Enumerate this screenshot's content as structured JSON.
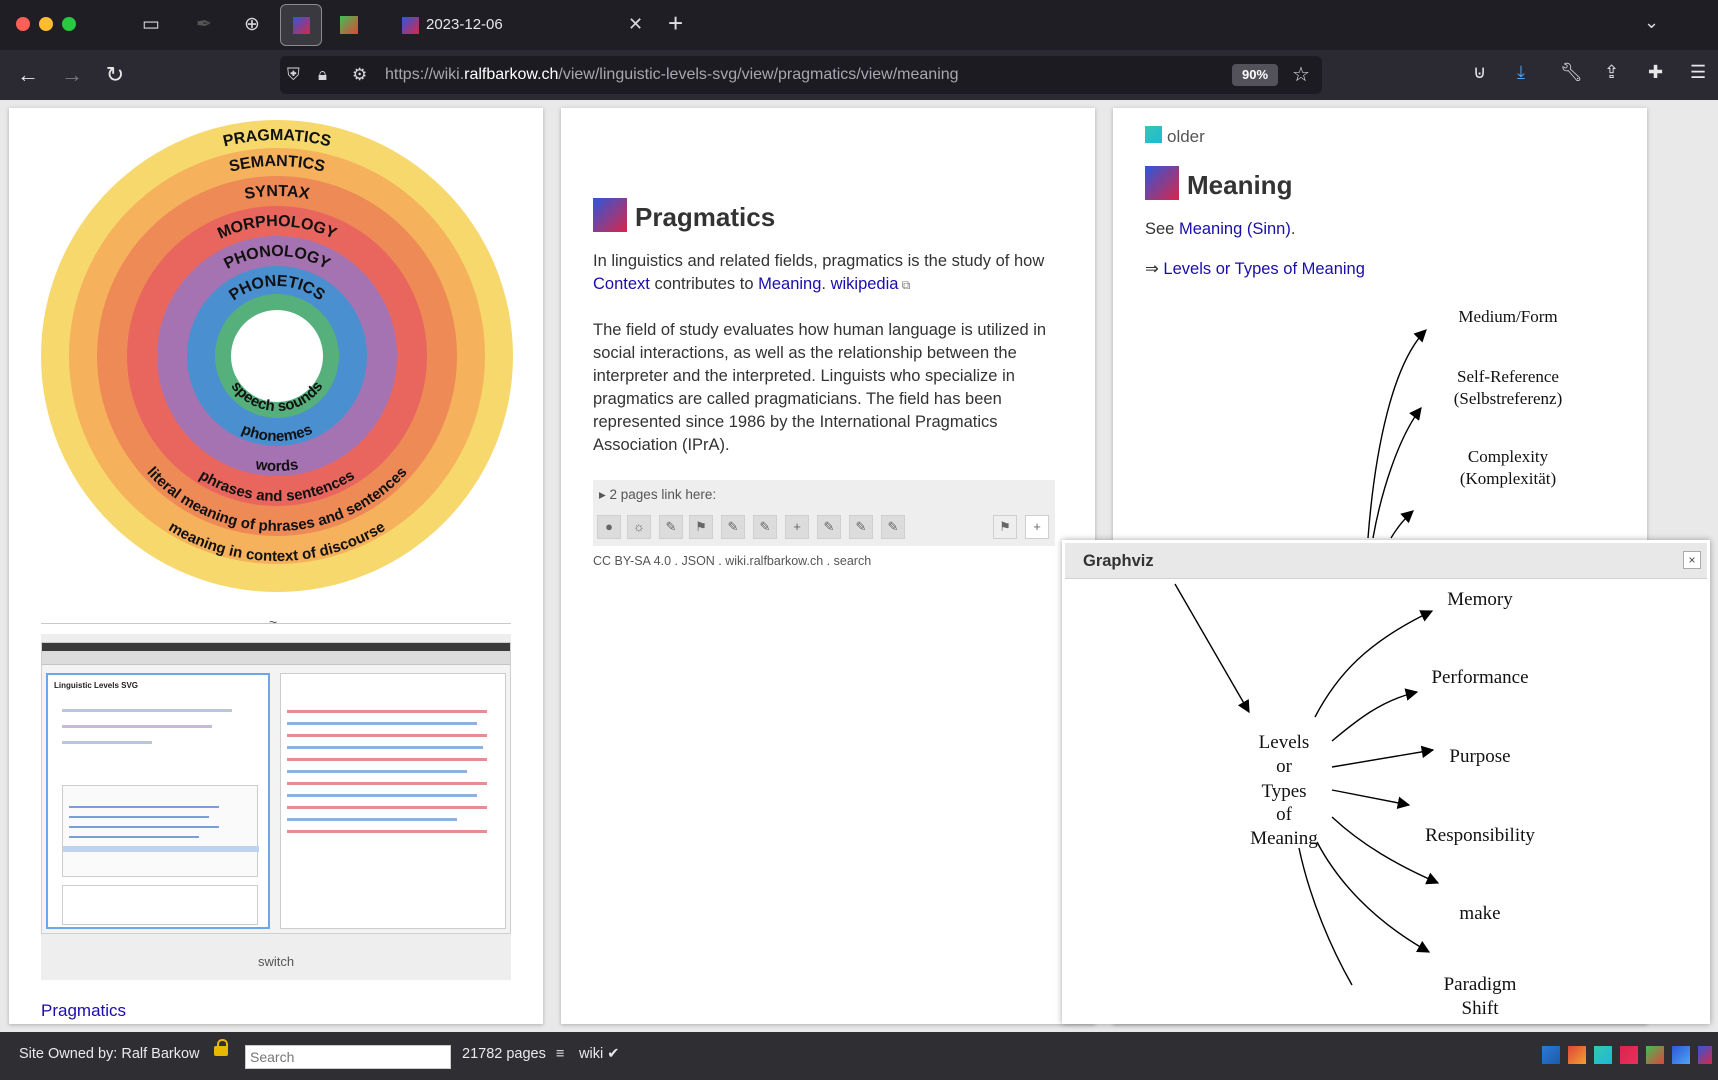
{
  "browser": {
    "tab_title": "2023-12-06",
    "url_prefix": "https://wiki.",
    "url_host": "ralfbarkow.ch",
    "url_path": "/view/linguistic-levels-svg/view/pragmatics/view/meaning",
    "zoom": "90%"
  },
  "left_page": {
    "rings_outer": [
      "PRAGMATICS",
      "SEMANTICS",
      "SYNTAX",
      "MORPHOLOGY",
      "PHONOLOGY",
      "PHONETICS"
    ],
    "rings_inner": [
      "speech sounds",
      "phonemes",
      "words",
      "phrases and sentences",
      "literal meaning of phrases and sentences",
      "meaning in context of discourse"
    ],
    "tilde": "~",
    "shot_title": "Linguistic Levels SVG",
    "caption": "switch",
    "link": "Pragmatics"
  },
  "mid_page": {
    "title": "Pragmatics",
    "p1_text_a": "In linguistics and related fields, pragmatics is the study of how ",
    "p1_link_context": "Context",
    "p1_text_b": " contributes to ",
    "p1_link_meaning": "Meaning",
    "p1_text_c": ". ",
    "p1_link_wikipedia": "wikipedia",
    "p2": "The field of study evaluates how human language is utilized in social interactions, as well as the relationship between the interpreter and the interpreted. Linguists who specialize in pragmatics are called pragmaticians. The field has been represented since 1986 by the International Pragmatics Association (IPrA).",
    "pages_link_here": "▸ 2 pages link here:",
    "license": "CC BY-SA 4.0",
    "json": "JSON",
    "site": "wiki.ralfbarkow.ch",
    "search": "search"
  },
  "right_page": {
    "older": "older",
    "title": "Meaning",
    "see_text": "See ",
    "see_link": "Meaning (Sinn)",
    "see_after": ".",
    "arrow": "⇒ ",
    "levels_link": "Levels or Types of Meaning",
    "graph_nodes": [
      "Medium/Form",
      "Self-Reference",
      "(Selbstreferenz)",
      "Complexity",
      "(Komplexität)"
    ]
  },
  "popup": {
    "title": "Graphviz",
    "close": "×",
    "center_lines": [
      "Levels",
      "or",
      "Types",
      "of",
      "Meaning"
    ],
    "nodes": [
      "Memory",
      "Performance",
      "Purpose",
      "Responsibility",
      "make",
      "Paradigm",
      "Shift"
    ]
  },
  "statusbar": {
    "owner": "Site Owned by: Ralf Barkow",
    "search_placeholder": "Search",
    "pages": "21782 pages",
    "menu": "≡",
    "wiki": "wiki ✔"
  },
  "colors": {
    "ring_colors": [
      "#f6d86c",
      "#f5b15c",
      "#ee8a56",
      "#e9665f",
      "#a673b2",
      "#4a8fd0",
      "#55b07c"
    ],
    "link": "#1a0dab"
  }
}
